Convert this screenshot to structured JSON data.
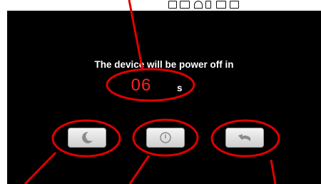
{
  "dialog": {
    "message": "The device will be power off in",
    "countdown": "06",
    "unit": "s"
  },
  "buttons": [
    {
      "name": "sleep",
      "icon": "moon-icon"
    },
    {
      "name": "power",
      "icon": "power-icon"
    },
    {
      "name": "back",
      "icon": "undo-arrow-icon"
    }
  ],
  "colors": {
    "background": "#000000",
    "countdown": "#ff2020",
    "annotation": "#e00000",
    "button": "#e6e6e6"
  }
}
